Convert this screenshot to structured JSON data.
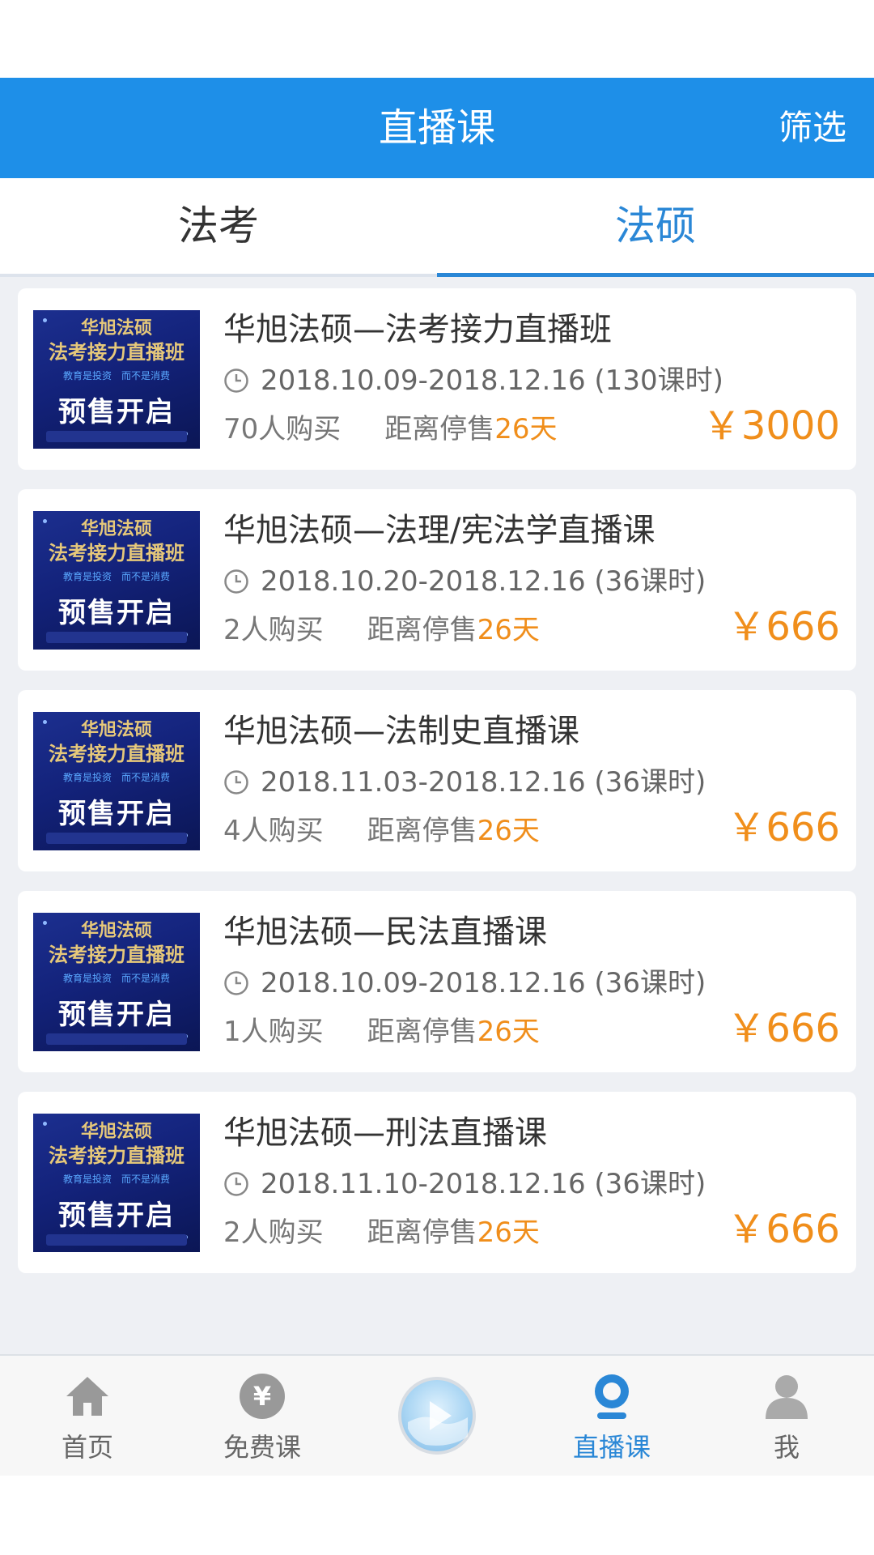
{
  "header": {
    "title": "直播课",
    "filter_label": "筛选"
  },
  "tabs": [
    {
      "label": "法考",
      "active": false
    },
    {
      "label": "法硕",
      "active": true
    }
  ],
  "thumbnail_text": {
    "line1": "华旭法硕",
    "line2": "法考接力直播班",
    "line3": "教育是投资　而不是消费",
    "line4": "预售开启"
  },
  "courses": [
    {
      "title": "华旭法硕—法考接力直播班",
      "dates": "2018.10.09-2018.12.16 (130课时)",
      "buyers": "70人购买",
      "stop_label": "距离停售",
      "days": "26天",
      "price": "￥3000"
    },
    {
      "title": "华旭法硕—法理/宪法学直播课",
      "dates": "2018.10.20-2018.12.16 (36课时)",
      "buyers": "2人购买",
      "stop_label": "距离停售",
      "days": "26天",
      "price": "￥666"
    },
    {
      "title": "华旭法硕—法制史直播课",
      "dates": "2018.11.03-2018.12.16 (36课时)",
      "buyers": "4人购买",
      "stop_label": "距离停售",
      "days": "26天",
      "price": "￥666"
    },
    {
      "title": "华旭法硕—民法直播课",
      "dates": "2018.10.09-2018.12.16 (36课时)",
      "buyers": "1人购买",
      "stop_label": "距离停售",
      "days": "26天",
      "price": "￥666"
    },
    {
      "title": "华旭法硕—刑法直播课",
      "dates": "2018.11.10-2018.12.16 (36课时)",
      "buyers": "2人购买",
      "stop_label": "距离停售",
      "days": "26天",
      "price": "￥666"
    }
  ],
  "tabbar": [
    {
      "label": "首页",
      "icon": "home-icon"
    },
    {
      "label": "免费课",
      "icon": "yen-coin-icon"
    },
    {
      "label": "",
      "icon": "play-icon"
    },
    {
      "label": "直播课",
      "icon": "live-icon",
      "active": true
    },
    {
      "label": "我",
      "icon": "user-icon"
    }
  ],
  "colors": {
    "primary": "#1e8fe8",
    "accent_blue": "#2a87d6",
    "price_orange": "#f08e1b",
    "list_bg": "#eef0f4"
  }
}
